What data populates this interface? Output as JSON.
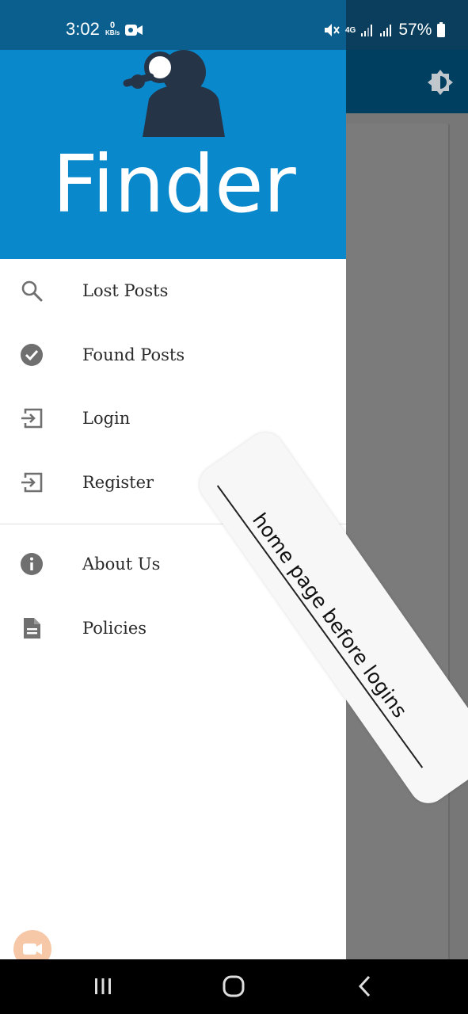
{
  "status_bar": {
    "time": "3:02",
    "net_speed_value": "0",
    "net_speed_unit": "KB/s",
    "network_type": "4G",
    "battery": "57%"
  },
  "drawer": {
    "brand": "Finder",
    "menu_primary": [
      {
        "label": "Lost Posts",
        "icon": "search-icon"
      },
      {
        "label": "Found Posts",
        "icon": "check-circle-icon"
      },
      {
        "label": "Login",
        "icon": "login-icon"
      },
      {
        "label": "Register",
        "icon": "register-icon"
      }
    ],
    "menu_secondary": [
      {
        "label": "About Us",
        "icon": "info-icon"
      },
      {
        "label": "Policies",
        "icon": "document-icon"
      }
    ]
  },
  "annotation": {
    "note": "home page before logins"
  },
  "colors": {
    "header_blue": "#0a88cc",
    "appbar_dark": "#003f5f",
    "icon_grey": "#6f6f6f"
  }
}
